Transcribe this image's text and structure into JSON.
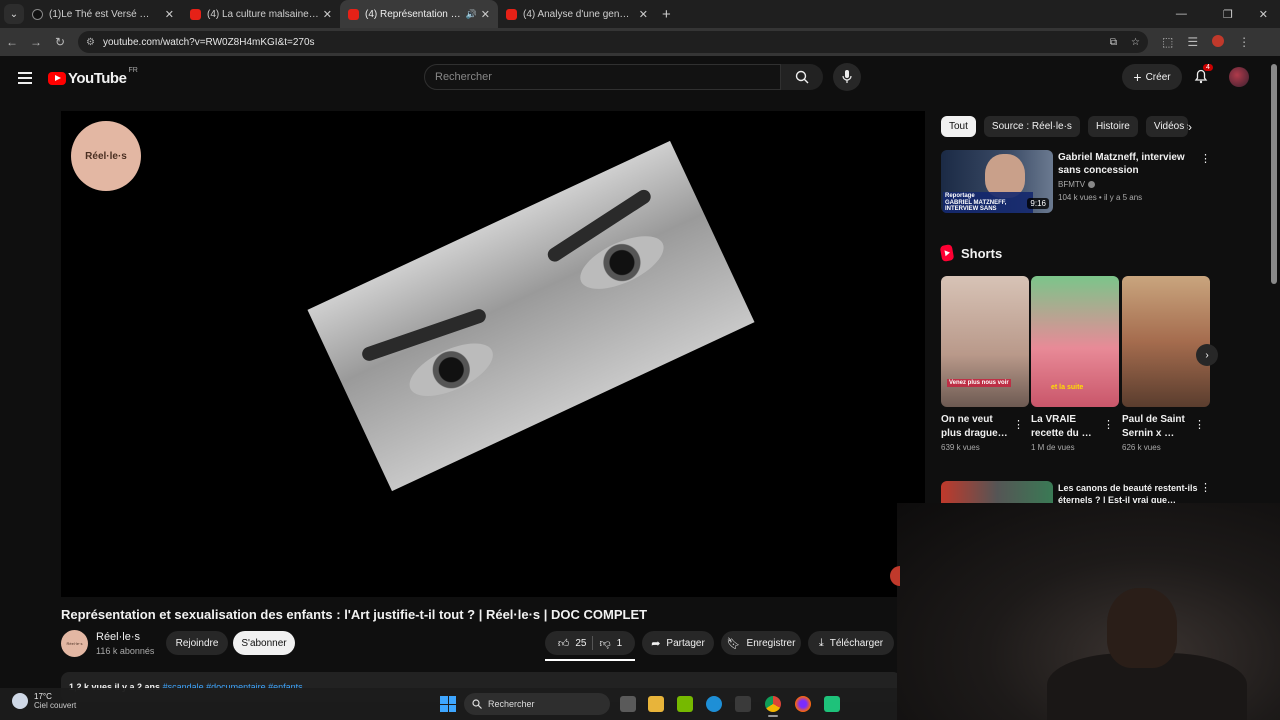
{
  "browser": {
    "tabs": [
      {
        "title": "(1)Le Thé est Versé 🫖 🍵 😊 (0",
        "icon": "tiktok-icon",
        "active": false
      },
      {
        "title": "(4) La culture malsaine du kawaï",
        "icon": "youtube-icon",
        "active": false
      },
      {
        "title": "(4) Représentation et sexualisation",
        "icon": "youtube-icon",
        "active": true,
        "audio": true
      },
      {
        "title": "(4) Analyse d'une genèse : le \"G",
        "icon": "youtube-icon",
        "active": false
      }
    ],
    "url": "youtube.com/watch?v=RW0Z8H4mKGI&t=270s"
  },
  "youtube": {
    "logo": "YouTube",
    "country": "FR",
    "search_placeholder": "Rechercher",
    "create_label": "Créer",
    "notifications": "4"
  },
  "video": {
    "watermark": "Réel·le·s",
    "title": "Représentation et sexualisation des enfants : l'Art justifie-t-il tout ? | Réel·le·s | DOC COMPLET",
    "channel": "Réel·le·s",
    "subscribers": "116 k abonnés",
    "join_label": "Rejoindre",
    "subscribe_label": "S'abonner",
    "likes": "25",
    "dislikes": "1",
    "share_label": "Partager",
    "save_label": "Enregistrer",
    "download_label": "Télécharger",
    "desc_meta": "1,2 k vues  il y a 2 ans",
    "desc_tags": "#scandale #documentaire #enfants"
  },
  "sidebar": {
    "chips": [
      "Tout",
      "Source : Réel·le·s",
      "Histoire",
      "Vidéos s"
    ],
    "rec1": {
      "title": "Gabriel Matzneff, interview sans concession",
      "channel": "BFMTV",
      "meta": "104 k vues • il y a 5 ans",
      "duration": "9:16",
      "thumb_caption": "GABRIEL MATZNEFF, INTERVIEW SANS CONCESSION",
      "thumb_tag": "Reportage"
    },
    "shorts_label": "Shorts",
    "shorts": [
      {
        "title": "On ne veut plus drague…",
        "views": "639 k vues",
        "overlay": "Venez plus nous voir"
      },
      {
        "title": "La VRAIE recette du …",
        "views": "1 M de vues",
        "overlay": "et la suite"
      },
      {
        "title": "Paul de Saint Sernin x …",
        "views": "626 k vues",
        "overlay": ""
      }
    ],
    "rec2": {
      "title": "Les canons de beauté restent-ils éternels ? | Est-il vrai que…"
    }
  },
  "taskbar": {
    "temp": "17°C",
    "weather": "Ciel couvert",
    "search": "Rechercher"
  }
}
